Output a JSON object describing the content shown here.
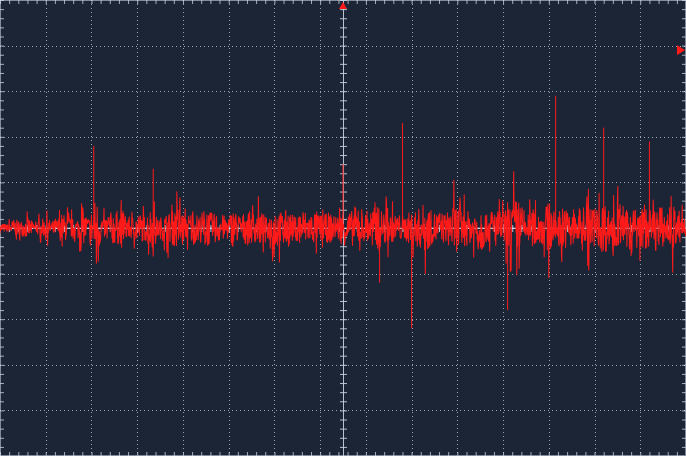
{
  "display": {
    "background": "#1c2535",
    "grid_color": "#c8d2e0",
    "trace_color": "#ff1a1a",
    "baseline_color": "#ffffff",
    "marker_color": "#ff1a1a",
    "divisions_x": 15,
    "divisions_y": 10,
    "minor_ticks_per_division": 5
  },
  "markers": {
    "trigger_position_icon": "triangle-down-icon",
    "trigger_level_icon": "triangle-left-icon",
    "trigger_level_fraction": 0.11
  },
  "chart_data": {
    "type": "line",
    "title": "",
    "xlabel": "",
    "ylabel": "",
    "units": "divisions",
    "xlim": [
      0,
      15
    ],
    "ylim": [
      -5,
      5
    ],
    "grid": true,
    "series": [
      {
        "x": [
          0.0,
          0.15,
          0.3,
          0.45,
          0.6,
          0.75,
          0.9,
          1.05,
          1.2,
          1.35,
          1.5,
          1.65,
          1.8,
          1.95,
          2.1,
          2.25,
          2.4,
          2.55,
          2.7,
          2.85,
          3.0,
          3.15,
          3.3,
          3.45,
          3.6,
          3.75,
          3.9,
          4.05,
          4.2,
          4.35,
          4.5,
          4.65,
          4.8,
          4.95,
          5.1,
          5.25,
          5.4,
          5.55,
          5.7,
          5.85,
          6.0,
          6.15,
          6.3,
          6.45,
          6.6,
          6.75,
          6.9,
          7.05,
          7.2,
          7.35,
          7.5,
          7.65,
          7.8,
          7.95,
          8.1,
          8.25,
          8.4,
          8.55,
          8.7,
          8.85,
          9.0,
          9.15,
          9.3,
          9.45,
          9.6,
          9.75,
          9.9,
          10.05,
          10.2,
          10.35,
          10.5,
          10.65,
          10.8,
          10.95,
          11.1,
          11.25,
          11.4,
          11.55,
          11.7,
          11.85,
          12.0,
          12.15,
          12.3,
          12.45,
          12.6,
          12.75,
          12.9,
          13.05,
          13.2,
          13.35,
          13.5,
          13.65,
          13.8,
          13.95,
          14.1,
          14.25,
          14.4,
          14.55,
          14.7,
          14.85,
          15.0
        ],
        "values": [
          0.3,
          -0.2,
          0.5,
          -0.4,
          0.6,
          -0.3,
          0.5,
          -0.5,
          0.4,
          -0.8,
          0.7,
          -0.4,
          1.0,
          -0.6,
          1.8,
          -0.5,
          0.9,
          -1.0,
          0.8,
          -0.6,
          0.9,
          -0.7,
          1.2,
          -0.5,
          0.8,
          -0.9,
          1.3,
          -0.6,
          1.0,
          -0.7,
          1.2,
          -0.8,
          0.9,
          -0.6,
          1.1,
          -0.7,
          1.0,
          -0.8,
          1.0,
          -0.5,
          1.4,
          -0.9,
          1.1,
          -0.6,
          1.2,
          -0.8,
          1.0,
          -0.7,
          0.9,
          -0.6,
          1.0,
          -0.9,
          1.2,
          -0.7,
          1.1,
          -1.2,
          1.0,
          -0.8,
          0.8,
          -0.7,
          1.0,
          -1.1,
          1.5,
          -0.9,
          1.0,
          -0.8,
          1.4,
          -1.3,
          1.0,
          -0.8,
          1.6,
          -0.7,
          1.2,
          -0.9,
          1.1,
          -1.8,
          1.3,
          -0.8,
          1.2,
          -0.9,
          1.5,
          -0.8,
          1.3,
          -0.9,
          1.4,
          -0.7,
          1.5,
          -0.8,
          1.6,
          -0.9,
          1.3,
          -0.7,
          1.7,
          -0.8,
          1.4,
          -0.9,
          1.6,
          -0.7,
          1.5,
          -0.6,
          1.0
        ],
        "color": "#ff1a1a"
      }
    ],
    "spikes": {
      "x": [
        2.05,
        3.35,
        7.5,
        8.8,
        9.0,
        12.15,
        13.2,
        14.2,
        11.1,
        8.3
      ],
      "values": [
        1.8,
        1.3,
        1.4,
        2.3,
        -2.2,
        2.9,
        2.2,
        1.9,
        -1.8,
        -1.2
      ]
    },
    "baseline": 0
  }
}
